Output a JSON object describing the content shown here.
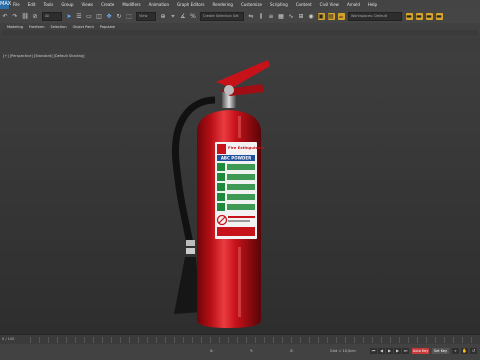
{
  "menu": {
    "app_logo": "MAX",
    "items": [
      "File",
      "Edit",
      "Tools",
      "Group",
      "Views",
      "Create",
      "Modifiers",
      "Animation",
      "Graph Editors",
      "Rendering",
      "Customize",
      "Scripting",
      "Content",
      "Civil View",
      "Arnold",
      "Help"
    ]
  },
  "toolbar": {
    "filter_value": "All",
    "view_value": "View",
    "selection_set_placeholder": "Create Selection Set",
    "workspace_value": "Workspaces: Default"
  },
  "ribbon": {
    "tabs": [
      "Modeling",
      "Freeform",
      "Selection",
      "Object Paint",
      "Populate"
    ]
  },
  "viewport": {
    "label": "[+] [Perspective] [Standard] [Default Shading]"
  },
  "timeline": {
    "frame": "0 / 100"
  },
  "status": {
    "x_label": "X:",
    "y_label": "Y:",
    "z_label": "Z:",
    "grid": "Grid = 10,0cm",
    "auto_key": "Auto Key",
    "set_key": "Set Key"
  },
  "extinguisher": {
    "header_text": "Fire Extinguisher",
    "type_text": "ABC POWDER",
    "colors": {
      "body": "#c8121a",
      "label_bg": "#f2f2f2",
      "label_green": "#1f8a3a",
      "label_blue": "#1d4f9a"
    }
  }
}
